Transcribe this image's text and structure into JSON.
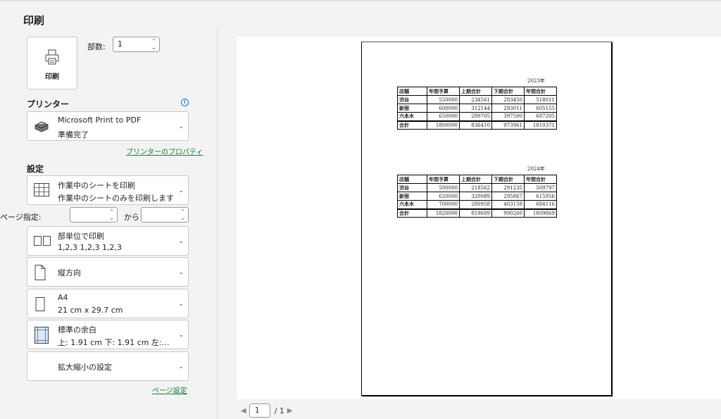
{
  "title": "印刷",
  "print_button": {
    "label": "印刷"
  },
  "copies": {
    "label": "部数:",
    "value": "1"
  },
  "printer": {
    "heading": "プリンター",
    "name": "Microsoft Print to PDF",
    "status": "準備完了",
    "properties_link": "プリンターのプロパティ"
  },
  "settings": {
    "heading": "設定",
    "what": {
      "line1": "作業中のシートを印刷",
      "line2": "作業中のシートのみを印刷します"
    },
    "pages": {
      "label": "ページ指定:",
      "to_label": "から",
      "from_value": "",
      "to_value": ""
    },
    "collate": {
      "line1": "部単位で印刷",
      "line2": "1,2,3    1,2,3    1,2,3"
    },
    "orientation": {
      "line1": "縦方向"
    },
    "paper": {
      "line1": "A4",
      "line2": "21 cm x 29.7 cm"
    },
    "margins": {
      "line1": "標準の余白",
      "line2": "上: 1.91 cm 下: 1.91 cm 左:…"
    },
    "scaling": {
      "line1": "拡大縮小の設定"
    },
    "page_setup_link": "ページ設定"
  },
  "pager": {
    "current": "1",
    "total": "/ 1"
  },
  "preview_tables": [
    {
      "year": "2023年",
      "headers": [
        "店舗",
        "年間予算",
        "上期合計",
        "下期合計",
        "年間合計"
      ],
      "rows": [
        [
          "渋谷",
          "550000",
          "234561",
          "283450",
          "518011"
        ],
        [
          "新宿",
          "600000",
          "312144",
          "293011",
          "605155"
        ],
        [
          "六本木",
          "650000",
          "289705",
          "397500",
          "687205"
        ]
      ],
      "total": [
        "合計",
        "1800000",
        "836410",
        "973961",
        "1810371"
      ]
    },
    {
      "year": "2024年",
      "headers": [
        "店舗",
        "年間予算",
        "上期合計",
        "下期合計",
        "年間合計"
      ],
      "rows": [
        [
          "渋谷",
          "500000",
          "218562",
          "291235",
          "509797"
        ],
        [
          "新宿",
          "620000",
          "320089",
          "295867",
          "615956"
        ],
        [
          "六本木",
          "700000",
          "280958",
          "403158",
          "684116"
        ]
      ],
      "total": [
        "合計",
        "1820000",
        "819609",
        "990260",
        "1809869"
      ]
    }
  ]
}
